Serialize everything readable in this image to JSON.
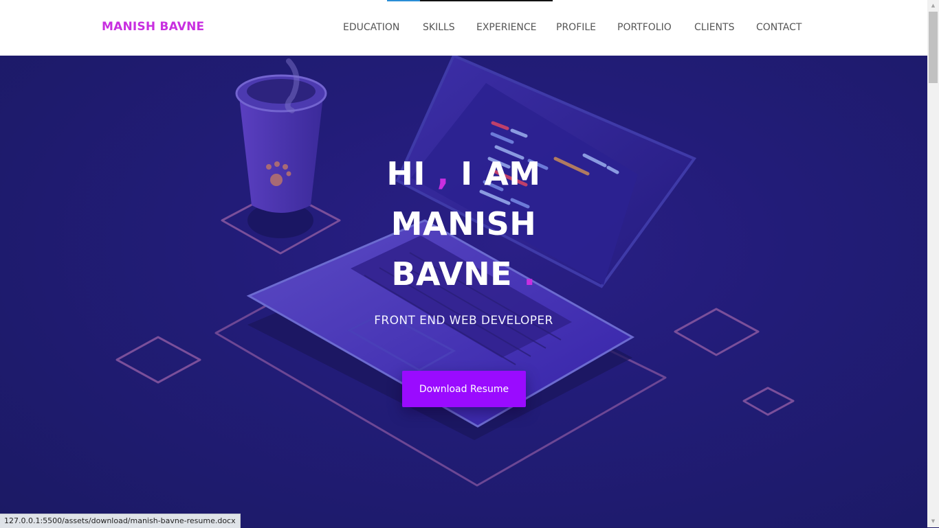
{
  "header": {
    "brand": "MANISH BAVNE",
    "nav": [
      "EDUCATION",
      "SKILLS",
      "EXPERIENCE",
      "PROFILE",
      "PORTFOLIO",
      "CLIENTS",
      "CONTACT"
    ]
  },
  "hero": {
    "greeting": "HI",
    "comma": ",",
    "i_am": "I AM",
    "first_name": "MANISH",
    "last_name": "BAVNE",
    "period": ".",
    "subtitle": "FRONT END WEB DEVELOPER",
    "cta_label": "Download Resume"
  },
  "status_bar": {
    "url": "127.0.0.1:5500/assets/download/manish-bavne-resume.docx"
  },
  "page_scroll_progress": 0.2,
  "colors": {
    "brand": "#c82fe0",
    "accent": "#c82fe0",
    "button": "#9a0bff",
    "hero_bg": "#1c1a66"
  }
}
